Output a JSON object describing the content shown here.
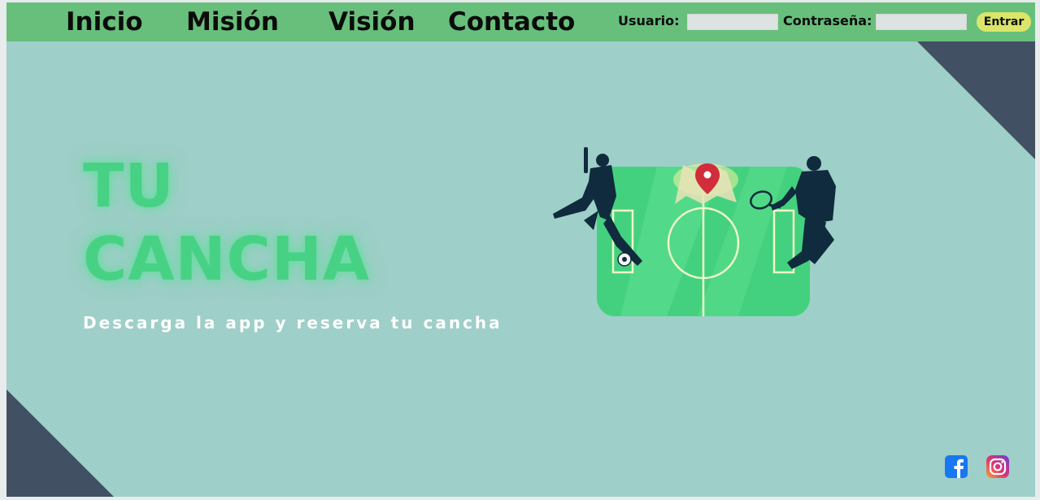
{
  "nav": {
    "links": [
      {
        "label": "Inicio"
      },
      {
        "label": "Misión"
      },
      {
        "label": "Visión"
      },
      {
        "label": "Contacto"
      }
    ]
  },
  "login": {
    "user_label": "Usuario:",
    "user_value": "",
    "password_label": "Contraseña:",
    "password_value": "",
    "submit_label": "Entrar"
  },
  "hero": {
    "title_line1": "TU",
    "title_line2": "CANCHA",
    "tagline": "Descarga la app y reserva tu cancha"
  },
  "social": {
    "icons": [
      "facebook-icon",
      "instagram-icon"
    ]
  },
  "colors": {
    "navbar": "#67bf7b",
    "background": "#9ecfc8",
    "corner_triangles": "#415063",
    "title": "#47d184",
    "button": "#dbe56a",
    "field": "#44d17f",
    "silhouette": "#0f2b3d"
  }
}
